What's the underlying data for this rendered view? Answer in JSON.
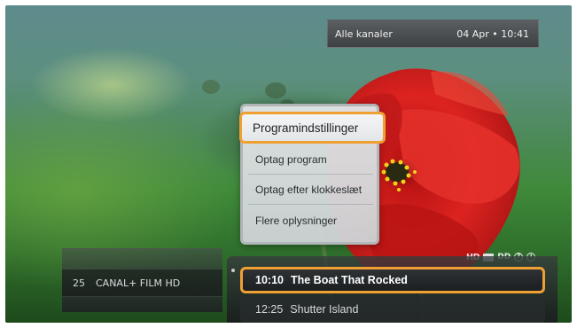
{
  "topbar": {
    "channel_filter": "Alle kanaler",
    "datetime": "04 Apr • 10:41"
  },
  "menu": {
    "items": [
      {
        "label": "Programindstillinger",
        "selected": true
      },
      {
        "label": "Optag program",
        "selected": false
      },
      {
        "label": "Optag efter klokkeslæt",
        "selected": false
      },
      {
        "label": "Flere oplysninger",
        "selected": false
      }
    ]
  },
  "channel": {
    "number": "25",
    "name": "CANAL+ FILM HD"
  },
  "programs": [
    {
      "time": "10:10",
      "title": "The Boat That Rocked",
      "selected": true
    },
    {
      "time": "12:25",
      "title": "Shutter Island",
      "selected": false
    }
  ],
  "status_icons": {
    "hd": "HD",
    "subtitles": "subtitles-icon",
    "dolby": "DD",
    "help": "?",
    "info": "i"
  },
  "colors": {
    "highlight": "#f0a032",
    "poppy_red": "#d81c1a"
  }
}
